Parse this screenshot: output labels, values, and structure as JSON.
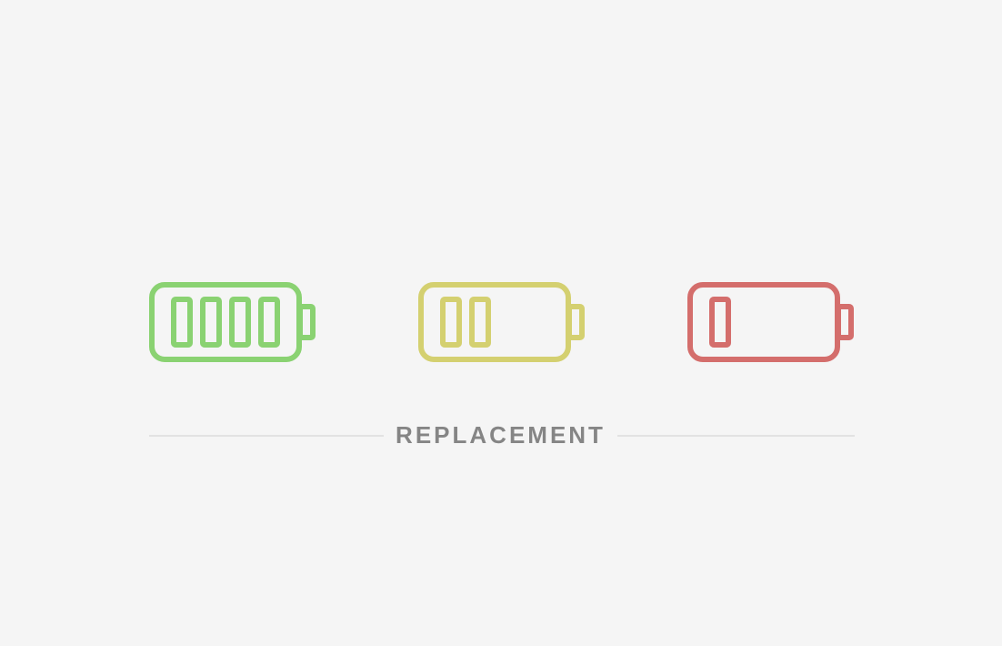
{
  "caption": "REPLACEMENT",
  "batteries": [
    {
      "id": "full",
      "charge_cells": 4,
      "color": "#8ad272"
    },
    {
      "id": "half",
      "charge_cells": 2,
      "color": "#d4d070"
    },
    {
      "id": "low",
      "charge_cells": 1,
      "color": "#d46e6c"
    }
  ],
  "colors": {
    "background": "#f5f5f5",
    "caption": "#858585",
    "divider": "#e2e2e2"
  },
  "icons": [
    "battery-full-icon",
    "battery-half-icon",
    "battery-low-icon"
  ]
}
